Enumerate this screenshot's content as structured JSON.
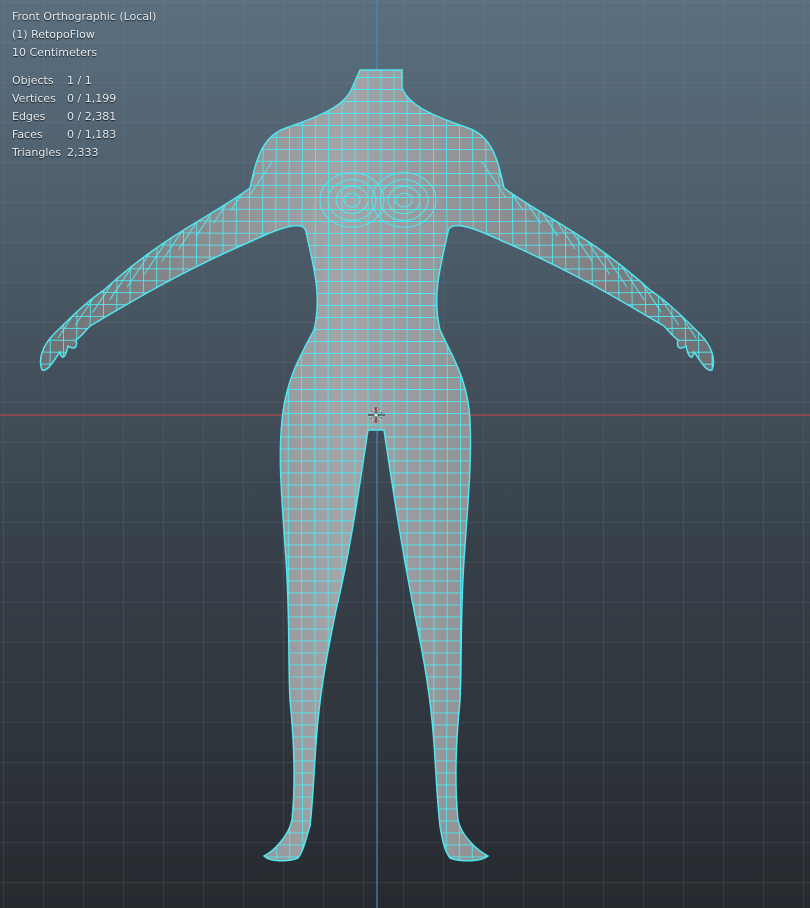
{
  "viewport": {
    "view_name": "Front Orthographic (Local)",
    "collection_object": "(1) RetopoFlow",
    "grid_scale": "10 Centimeters"
  },
  "statistics": [
    {
      "label": "Objects",
      "value": "1 / 1"
    },
    {
      "label": "Vertices",
      "value": "0 / 1,199"
    },
    {
      "label": "Edges",
      "value": "0 / 2,381"
    },
    {
      "label": "Faces",
      "value": "0 / 1,183"
    },
    {
      "label": "Triangles",
      "value": "2,333"
    }
  ],
  "colors": {
    "wireframe": "#52e6f0",
    "mesh_fill": "#8a8c8f",
    "x_axis": "#b04a4a",
    "z_axis": "#4a87c4",
    "grid_line": "#6b7c89"
  },
  "icons": {
    "origin_marker": "object-origin-icon",
    "cursor_3d": "3d-cursor-icon"
  }
}
